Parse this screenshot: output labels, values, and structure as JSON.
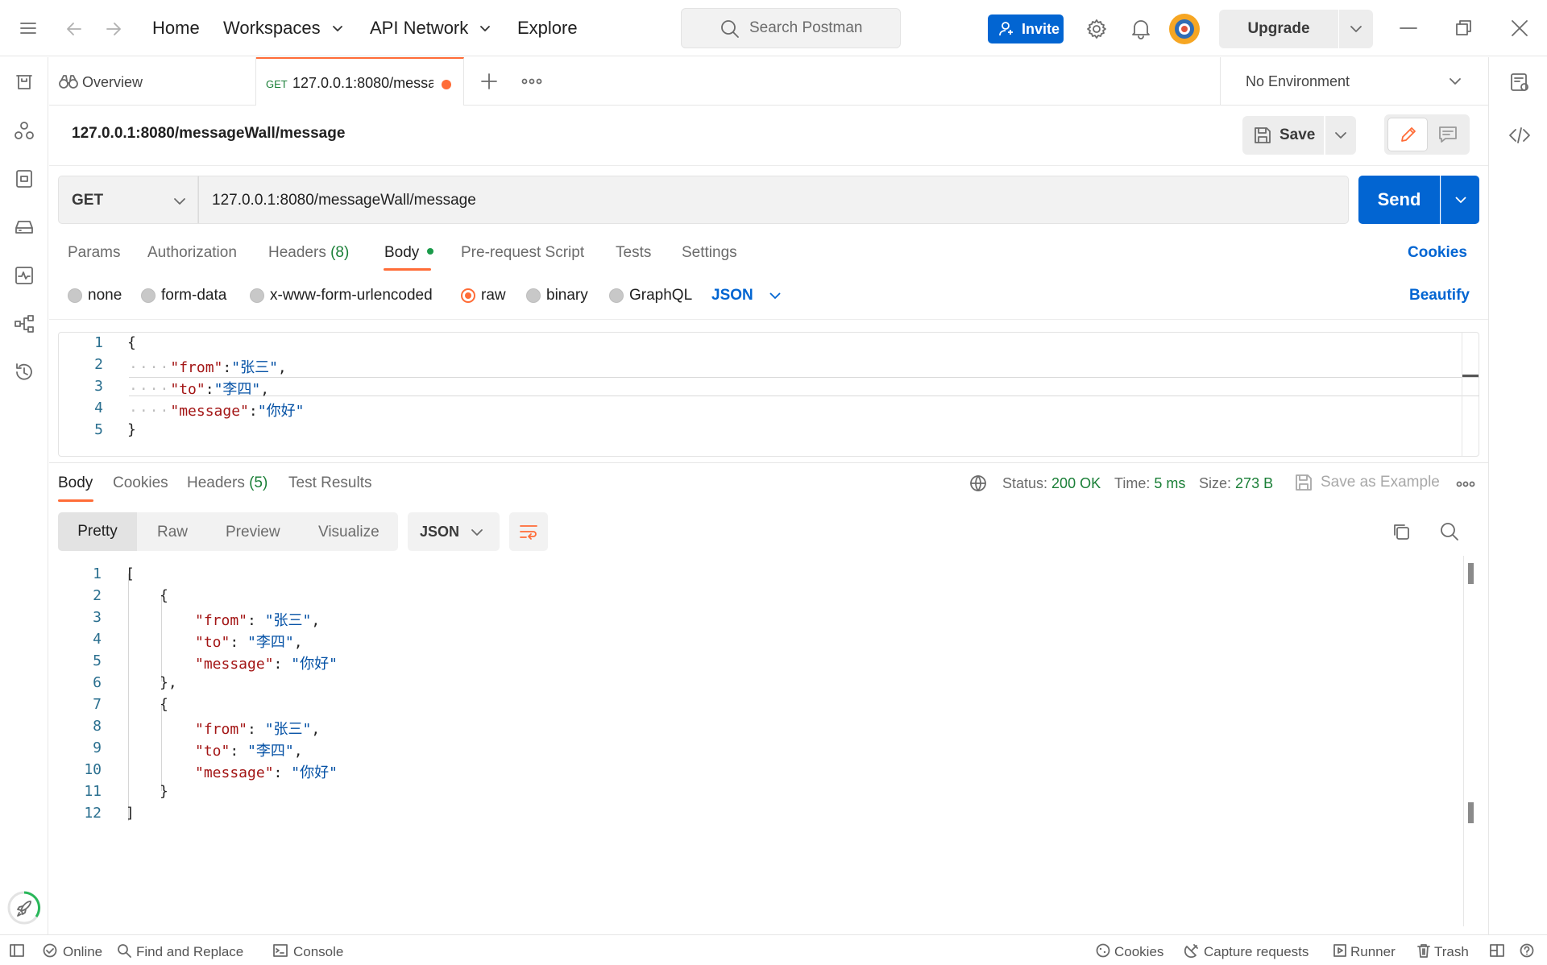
{
  "topbar": {
    "nav": [
      "Home",
      "Workspaces",
      "API Network",
      "Explore"
    ],
    "search_placeholder": "Search Postman",
    "invite_label": "Invite",
    "upgrade_label": "Upgrade"
  },
  "tabs": {
    "overview_label": "Overview",
    "request_method": "GET",
    "request_label": "127.0.0.1:8080/messag",
    "environment": "No Environment"
  },
  "request": {
    "title": "127.0.0.1:8080/messageWall/message",
    "save_label": "Save",
    "method": "GET",
    "url": "127.0.0.1:8080/messageWall/message",
    "send_label": "Send",
    "subtabs": {
      "params": "Params",
      "authorization": "Authorization",
      "headers": "Headers",
      "headers_count": "(8)",
      "body": "Body",
      "prerequest": "Pre-request Script",
      "tests": "Tests",
      "settings": "Settings"
    },
    "cookies_label": "Cookies",
    "body_modes": [
      "none",
      "form-data",
      "x-www-form-urlencoded",
      "raw",
      "binary",
      "GraphQL"
    ],
    "selected_body_mode": "raw",
    "body_format": "JSON",
    "beautify_label": "Beautify",
    "body_lines": [
      {
        "n": "1",
        "text": "{"
      },
      {
        "n": "2",
        "key": "\"from\"",
        "sep": ":",
        "val": "\"张三\"",
        "end": ","
      },
      {
        "n": "3",
        "key": "\"to\"",
        "sep": ":",
        "val": "\"李四\"",
        "end": ","
      },
      {
        "n": "4",
        "key": "\"message\"",
        "sep": ":",
        "val": "\"你好\"",
        "end": ""
      },
      {
        "n": "5",
        "text": "}"
      }
    ]
  },
  "response": {
    "tabs": {
      "body": "Body",
      "cookies": "Cookies",
      "headers": "Headers",
      "headers_count": "(5)",
      "test_results": "Test Results"
    },
    "status_label": "Status:",
    "status_value": "200 OK",
    "time_label": "Time:",
    "time_value": "5 ms",
    "size_label": "Size:",
    "size_value": "273 B",
    "save_example_label": "Save as Example",
    "views": [
      "Pretty",
      "Raw",
      "Preview",
      "Visualize"
    ],
    "format": "JSON",
    "line_numbers": [
      "1",
      "2",
      "3",
      "4",
      "5",
      "6",
      "7",
      "8",
      "9",
      "10",
      "11",
      "12"
    ],
    "items": [
      {
        "from": "\"张三\"",
        "to": "\"李四\"",
        "message": "\"你好\""
      },
      {
        "from": "\"张三\"",
        "to": "\"李四\"",
        "message": "\"你好\""
      }
    ],
    "keys": {
      "from": "\"from\"",
      "to": "\"to\"",
      "message": "\"message\""
    }
  },
  "statusbar": {
    "online": "Online",
    "find_replace": "Find and Replace",
    "console": "Console",
    "cookies": "Cookies",
    "capture": "Capture requests",
    "runner": "Runner",
    "trash": "Trash"
  },
  "colors": {
    "accent_orange": "#ff6c37",
    "primary_blue": "#0265d2",
    "status_green": "#1a7f37"
  }
}
